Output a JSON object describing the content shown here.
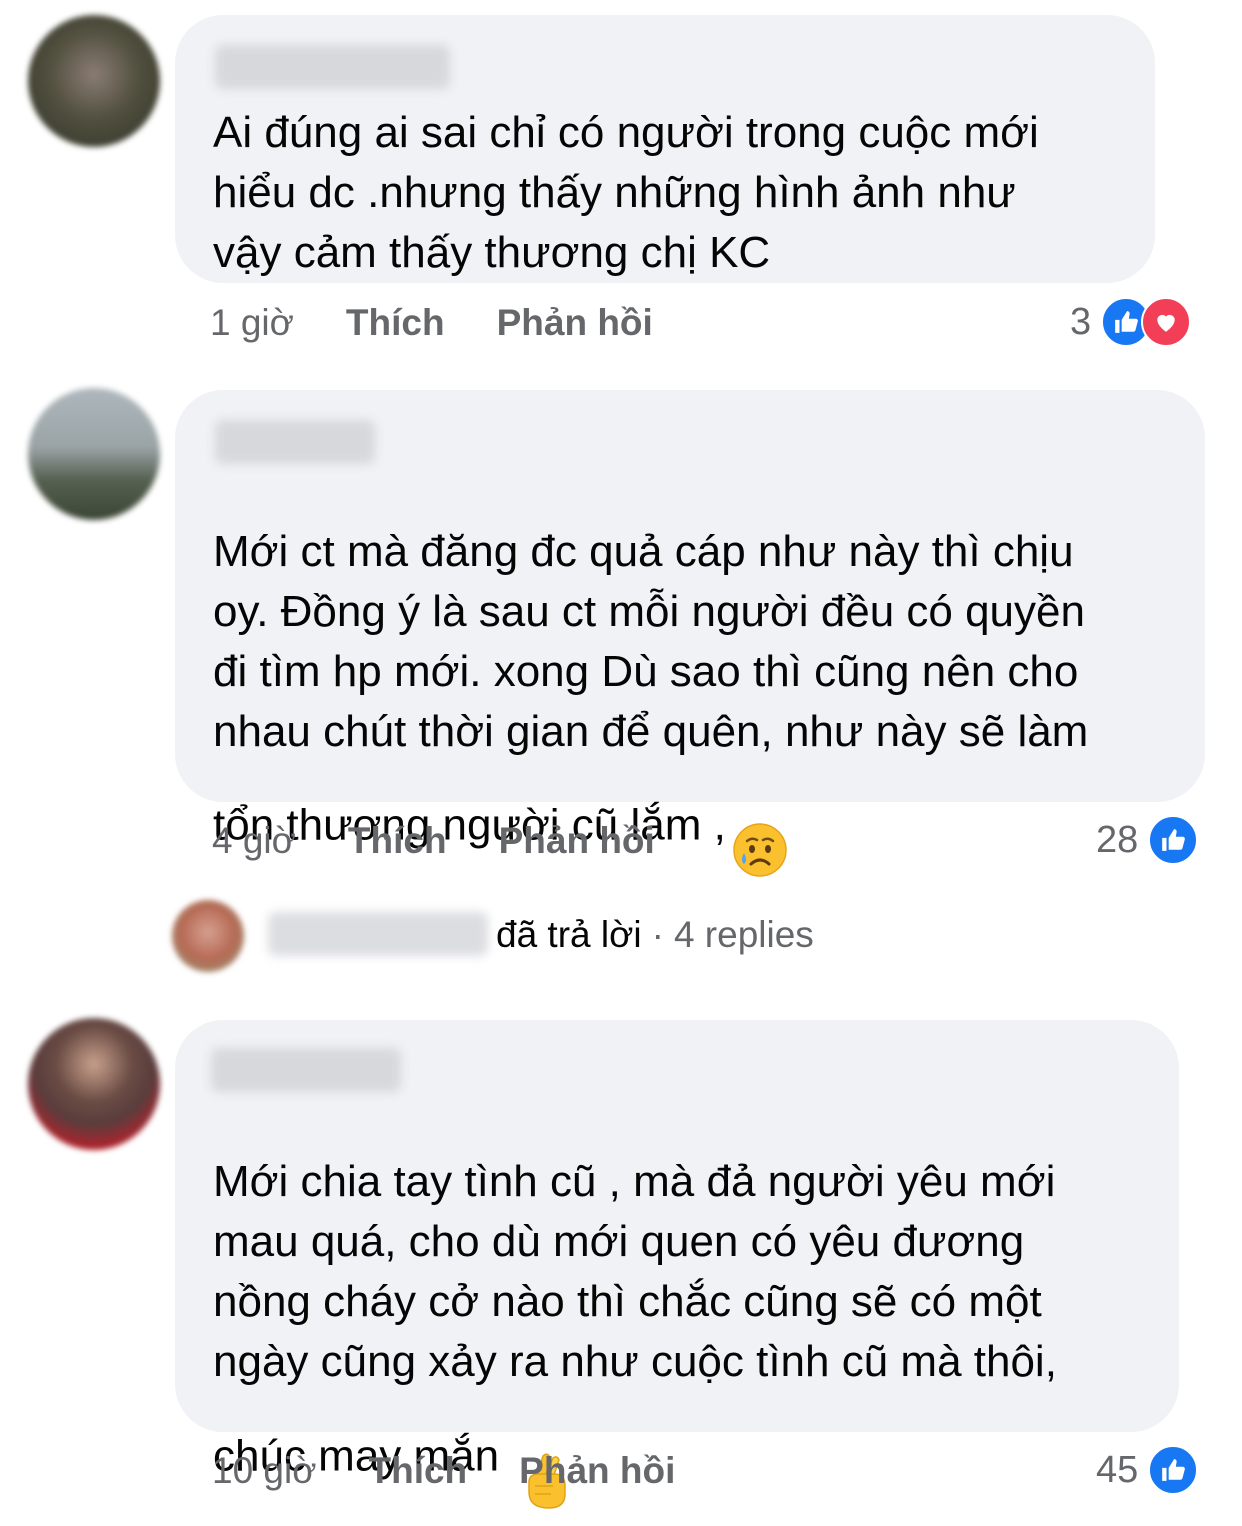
{
  "comments": [
    {
      "text": "Ai đúng ai sai chỉ có người trong cuộc mới\nhiểu dc .nhưng thấy những hình ảnh như\nvậy cảm thấy thương chị KC",
      "time": "1 giờ",
      "like_label": "Thích",
      "reply_label": "Phản hồi",
      "reaction_count": "3",
      "reactions": [
        "like-icon",
        "love-icon"
      ]
    },
    {
      "text": "Mới ct mà đăng đc quả cáp như này thì chịu\noy. Đồng ý là sau ct mỗi người đều có quyền\nđi tìm hp mới. xong Dù sao thì cũng nên cho\nnhau chút thời gian để quên, như này sẽ làm\ntổn thương người cũ lắm ,",
      "emoji": "sad-tear-emoji",
      "time": "4 giờ",
      "like_label": "Thích",
      "reply_label": "Phản hồi",
      "reaction_count": "28",
      "reactions": [
        "like-icon"
      ]
    },
    {
      "text": "Mới chia tay tình cũ , mà đả người yêu mới\nmau quá, cho dù mới quen có yêu đương\nnồng cháy cở nào thì chắc cũng sẽ có một\nngày cũng xảy ra như cuộc tình cũ mà thôi,\nchúc may mắn",
      "emoji": "crossed-fingers-emoji",
      "time": "10 giờ",
      "like_label": "Thích",
      "reply_label": "Phản hồi",
      "reaction_count": "45",
      "reactions": [
        "like-icon"
      ]
    }
  ],
  "reply_summary": {
    "replied_label": "đã trả lời",
    "separator": "·",
    "replies_count": "4 replies"
  },
  "colors": {
    "bubble": "#f0f2f5",
    "meta_text": "#65676b",
    "like_blue": "#1877f2",
    "love_red": "#f33e58"
  }
}
